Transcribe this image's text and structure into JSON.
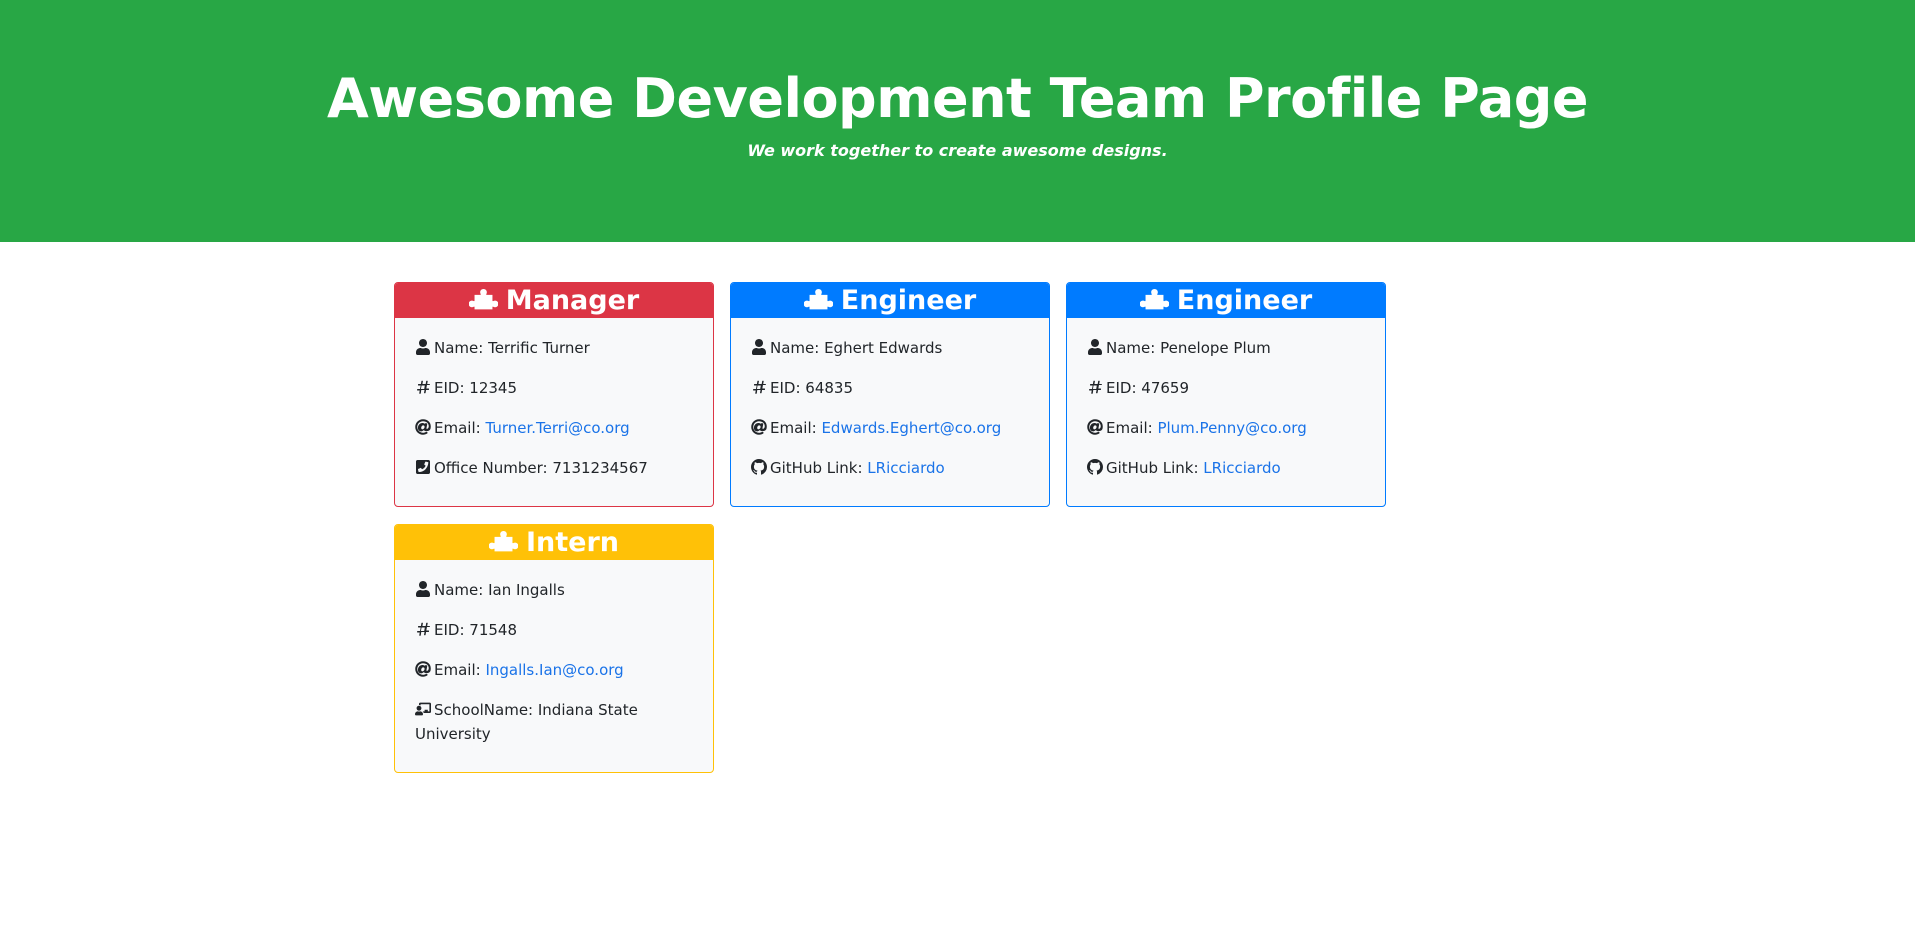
{
  "header": {
    "title": "Awesome Development Team Profile Page",
    "tagline": "We work together to create awesome designs."
  },
  "colors": {
    "jumbotron": "#28a745",
    "manager": "#dc3545",
    "engineer": "#007bff",
    "intern": "#ffc107",
    "link": "#1a73e8"
  },
  "cards": [
    {
      "role": "Manager",
      "name_label": "Name: ",
      "name": "Terrific Turner",
      "eid_label": "EID: ",
      "eid": "12345",
      "email_label": "Email: ",
      "email": "Turner.Terri@co.org",
      "extra_label": "Office Number: ",
      "extra": "7131234567",
      "extra_icon": "phone-square-icon"
    },
    {
      "role": "Engineer",
      "name_label": "Name: ",
      "name": "Eghert Edwards",
      "eid_label": "EID: ",
      "eid": "64835",
      "email_label": "Email: ",
      "email": "Edwards.Eghert@co.org",
      "extra_label": "GitHub Link: ",
      "extra": "LRicciardo",
      "extra_icon": "github-icon"
    },
    {
      "role": "Engineer",
      "name_label": "Name: ",
      "name": "Penelope Plum",
      "eid_label": "EID: ",
      "eid": "47659",
      "email_label": "Email: ",
      "email": "Plum.Penny@co.org",
      "extra_label": "GitHub Link: ",
      "extra": "LRicciardo",
      "extra_icon": "github-icon"
    },
    {
      "role": "Intern",
      "name_label": "Name: ",
      "name": "Ian Ingalls",
      "eid_label": "EID: ",
      "eid": "71548",
      "email_label": "Email: ",
      "email": "Ingalls.Ian@co.org",
      "extra_label": "SchoolName: ",
      "extra": "Indiana State University",
      "extra_icon": "chalkboard-teacher-icon"
    }
  ]
}
